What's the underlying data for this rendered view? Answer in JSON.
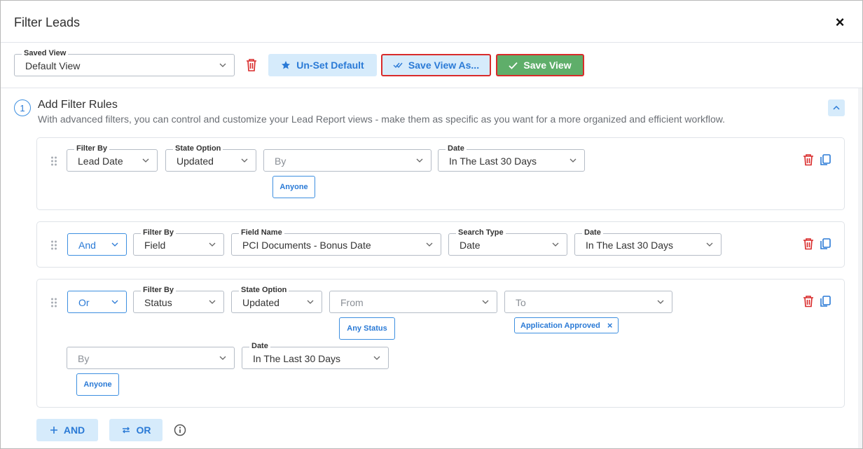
{
  "header": {
    "title": "Filter Leads",
    "close": "×"
  },
  "toolbar": {
    "saved_view_label": "Saved View",
    "saved_view_value": "Default View",
    "unset_default": "Un-Set Default",
    "save_view_as": "Save View As...",
    "save_view": "Save View"
  },
  "section": {
    "number": "1",
    "title": "Add Filter Rules",
    "description": "With advanced filters, you can control and customize your Lead Report views - make them as specific as you want for a more organized and efficient workflow."
  },
  "rule1": {
    "filter_by_label": "Filter By",
    "filter_by": "Lead Date",
    "state_option_label": "State Option",
    "state_option": "Updated",
    "by_placeholder": "By",
    "anyone": "Anyone",
    "date_label": "Date",
    "date": "In The Last 30 Days"
  },
  "rule2": {
    "connector": "And",
    "filter_by_label": "Filter By",
    "filter_by": "Field",
    "field_name_label": "Field Name",
    "field_name": "PCI Documents - Bonus Date",
    "search_type_label": "Search Type",
    "search_type": "Date",
    "date_label": "Date",
    "date": "In The Last 30 Days"
  },
  "rule3": {
    "connector": "Or",
    "filter_by_label": "Filter By",
    "filter_by": "Status",
    "state_option_label": "State Option",
    "state_option": "Updated",
    "from_placeholder": "From",
    "any_status": "Any Status",
    "to_placeholder": "To",
    "to_tag": "Application Approved",
    "tag_remove": "×",
    "by_placeholder": "By",
    "anyone": "Anyone",
    "date_label": "Date",
    "date": "In The Last 30 Days"
  },
  "footer": {
    "add_and": "AND",
    "add_or": "OR"
  },
  "colors": {
    "accent": "#2a7ad6",
    "accent_light": "#d6ebfb",
    "danger": "#d92b2b",
    "success": "#5fae6a"
  }
}
